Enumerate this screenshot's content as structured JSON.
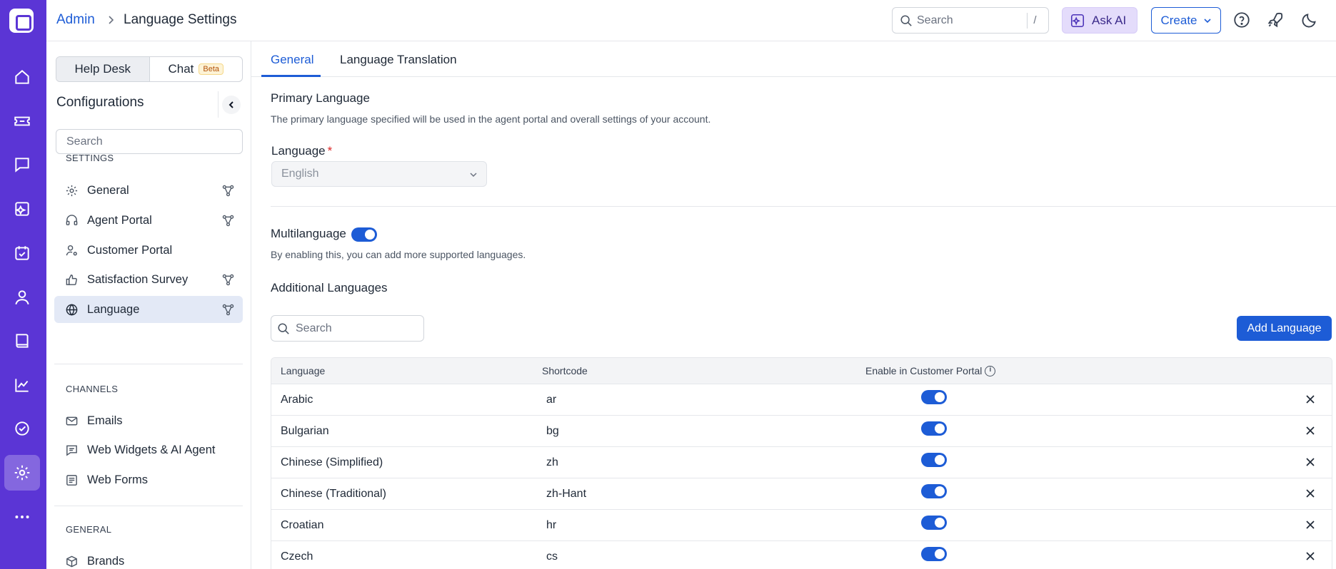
{
  "topbar": {
    "breadcrumb_root": "Admin",
    "page_title": "Language Settings",
    "search_placeholder": "Search",
    "search_shortcut": "/",
    "ask_ai_label": "Ask AI",
    "create_label": "Create"
  },
  "rail": {
    "items": [
      "home-icon",
      "ticket-icon",
      "chat-icon",
      "ai-agent-icon",
      "task-icon",
      "contacts-icon",
      "knowledge-base-icon",
      "analytics-icon",
      "approvals-icon",
      "settings-icon",
      "more-icon"
    ],
    "active": "settings-icon"
  },
  "sidebar": {
    "segment_helpdesk": "Help Desk",
    "segment_chat": "Chat",
    "beta_badge": "Beta",
    "title": "Configurations",
    "search_placeholder": "Search",
    "section_settings": "SETTINGS",
    "settings_items": [
      {
        "label": "General",
        "icon": "gear-icon"
      },
      {
        "label": "Agent Portal",
        "icon": "headset-icon"
      },
      {
        "label": "Customer Portal",
        "icon": "user-gear-icon"
      },
      {
        "label": "Satisfaction Survey",
        "icon": "thumbs-up-icon"
      },
      {
        "label": "Language",
        "icon": "globe-icon"
      }
    ],
    "section_channels": "CHANNELS",
    "channel_items": [
      {
        "label": "Emails",
        "icon": "envelope-icon"
      },
      {
        "label": "Web Widgets & AI Agent",
        "icon": "widget-icon"
      },
      {
        "label": "Web Forms",
        "icon": "form-icon"
      }
    ],
    "section_general": "GENERAL",
    "general_items": [
      {
        "label": "Brands",
        "icon": "cube-icon"
      }
    ]
  },
  "tabs": {
    "general": "General",
    "translation": "Language Translation"
  },
  "primary": {
    "heading": "Primary Language",
    "description": "The primary language specified will be used in the agent portal and overall settings of your account.",
    "field_label": "Language",
    "required_mark": "*",
    "selected": "English"
  },
  "multilanguage": {
    "label": "Multilanguage",
    "enabled": true,
    "description": "By enabling this, you can add more supported languages."
  },
  "additional": {
    "heading": "Additional Languages",
    "search_placeholder": "Search",
    "add_button": "Add Language",
    "columns": {
      "language": "Language",
      "shortcode": "Shortcode",
      "portal": "Enable in Customer Portal"
    },
    "rows": [
      {
        "language": "Arabic",
        "shortcode": "ar",
        "enabled": true
      },
      {
        "language": "Bulgarian",
        "shortcode": "bg",
        "enabled": true
      },
      {
        "language": "Chinese (Simplified)",
        "shortcode": "zh",
        "enabled": true
      },
      {
        "language": "Chinese (Traditional)",
        "shortcode": "zh-Hant",
        "enabled": true
      },
      {
        "language": "Croatian",
        "shortcode": "hr",
        "enabled": true
      },
      {
        "language": "Czech",
        "shortcode": "cs",
        "enabled": true
      }
    ]
  },
  "colors": {
    "rail": "#5b35d5",
    "accent": "#1d5cd6",
    "active_nav": "#e3e9f6"
  }
}
